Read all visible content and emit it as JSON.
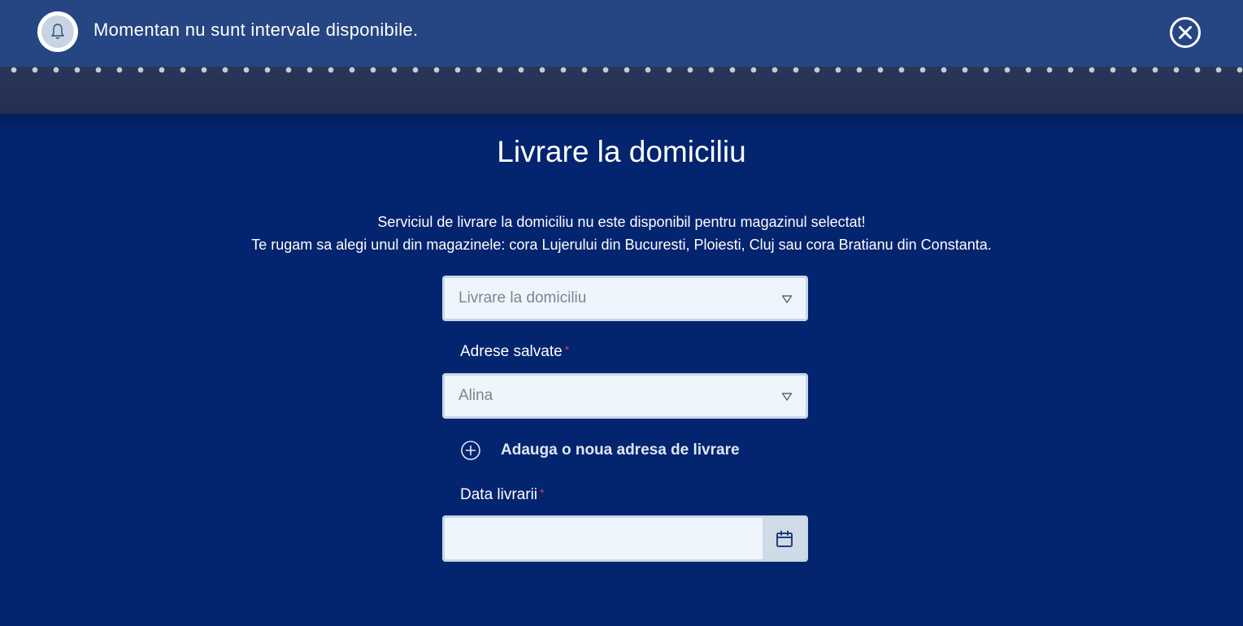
{
  "notification": {
    "message": "Momentan nu sunt intervale disponibile.",
    "icon": "bell-icon",
    "close_icon": "close-icon"
  },
  "page": {
    "title": "Livrare la domiciliu",
    "info_line1": "Serviciul de livrare la domiciliu nu este disponibil pentru magazinul selectat!",
    "info_line2": "Te rugam sa alegi unul din magazinele: cora Lujerului din Bucuresti, Ploiesti, Cluj sau cora Bratianu din Constanta."
  },
  "form": {
    "delivery_type": {
      "value": "Livrare la domiciliu"
    },
    "saved_addresses": {
      "label": "Adrese salvate",
      "required_mark": "*",
      "value": "Alina"
    },
    "add_address": {
      "label": "Adauga o noua adresa de livrare",
      "icon": "plus-circle-icon"
    },
    "delivery_date": {
      "label": "Data livrarii",
      "required_mark": "*",
      "value": "",
      "icon": "calendar-icon"
    }
  },
  "colors": {
    "background": "#03246f",
    "banner": "#254583",
    "input_bg": "#eef5fd",
    "required": "#e03a4a"
  }
}
